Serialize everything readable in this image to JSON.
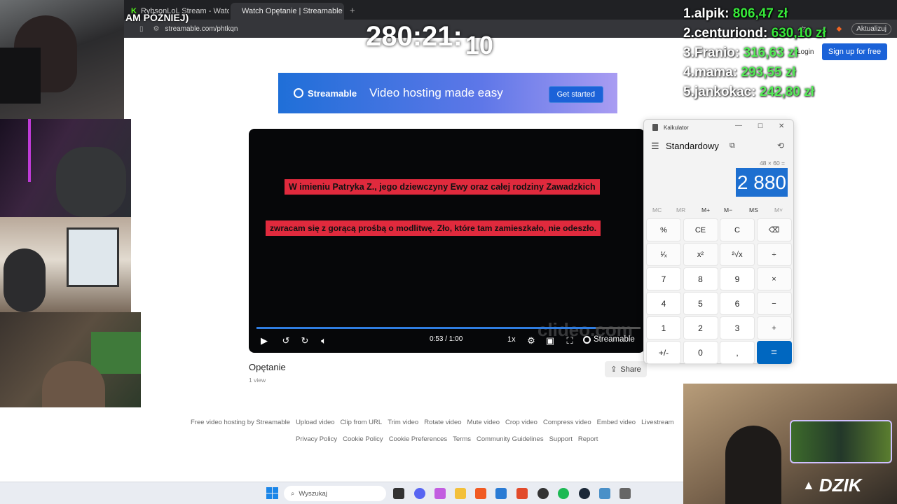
{
  "browser": {
    "tabs": [
      {
        "label": "RybsonLoL Stream - Watch Live on K"
      },
      {
        "label": "Watch Opętanie | Streamable"
      }
    ],
    "url": "streamable.com/phtkqn",
    "update_label": "Aktualizuj"
  },
  "overlay": {
    "top_left_text": "AM PÓŹNIEJ)",
    "timer": "280:21:",
    "timer_suffix": "10",
    "leaderboard": [
      {
        "rank": "1.",
        "name": "alpik:",
        "amount": "806,47 zł"
      },
      {
        "rank": "2.",
        "name": "centuriond:",
        "amount": "630,10 zł"
      },
      {
        "rank": "3.",
        "name": "Franio:",
        "amount": "316,63 zł"
      },
      {
        "rank": "4.",
        "name": "mama:",
        "amount": "293,55 zł"
      },
      {
        "rank": "5.",
        "name": "jankokac:",
        "amount": "242,80 zł"
      }
    ],
    "brand": "DZIK"
  },
  "site": {
    "login_label": "Login",
    "signup_label": "Sign up for free",
    "banner": {
      "logo": "Streamable",
      "tagline": "Video hosting made easy",
      "cta": "Get started"
    },
    "video": {
      "caption_1": "W imieniu Patryka Z., jego dziewczyny Ewy oraz całej rodziny Zawadzkich",
      "caption_2": "zwracam się z gorącą prośbą o modlitwę. Zło, które tam zamieszkało, nie odeszło.",
      "watermark": "clideo.com",
      "time": "0:53 / 1:00",
      "progress": 0.883,
      "speed": "1x",
      "brand": "Streamable"
    },
    "title": "Opętanie",
    "views": "1 view",
    "share_label": "Share",
    "footer_row1": [
      "Free video hosting by Streamable",
      "Upload video",
      "Clip from URL",
      "Trim video",
      "Rotate video",
      "Mute video",
      "Crop video",
      "Compress video",
      "Embed video",
      "Livestream"
    ],
    "footer_row2": [
      "Privacy Policy",
      "Cookie Policy",
      "Cookie Preferences",
      "Terms",
      "Community Guidelines",
      "Support",
      "Report"
    ]
  },
  "calculator": {
    "window_title": "Kalkulator",
    "mode": "Standardowy",
    "expression": "48 × 60 =",
    "display": "2 880",
    "memory": [
      "MC",
      "MR",
      "M+",
      "M−",
      "MS",
      "M˅"
    ],
    "keys": [
      [
        "%",
        "CE",
        "C",
        "⌫"
      ],
      [
        "¹⁄ₓ",
        "x²",
        "²√x",
        "÷"
      ],
      [
        "7",
        "8",
        "9",
        "×"
      ],
      [
        "4",
        "5",
        "6",
        "−"
      ],
      [
        "1",
        "2",
        "3",
        "+"
      ],
      [
        "+/-",
        "0",
        ",",
        "="
      ]
    ]
  },
  "taskbar": {
    "search_placeholder": "Wyszukaj"
  }
}
